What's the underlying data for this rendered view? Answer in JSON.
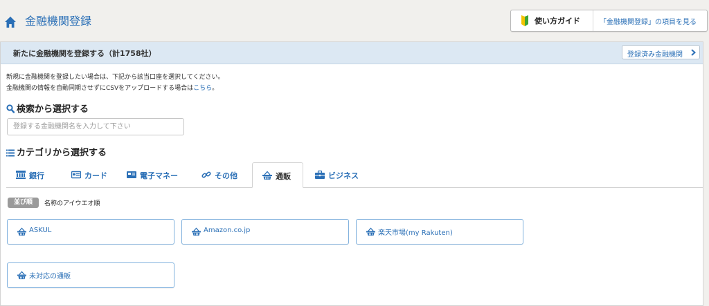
{
  "header": {
    "title": "金融機関登録",
    "guide_label": "使い方ガイド",
    "guide_link": "「金融機関登録」の項目を見る"
  },
  "panel": {
    "title": "新たに金融機関を登録する（計1758社）",
    "registered_button": "登録済み金融機関"
  },
  "intro": {
    "line1": "新規に金融機関を登録したい場合は、下記から該当口座を選択してください。",
    "line2_prefix": "金融機関の情報を自動同期させずにCSVをアップロードする場合は",
    "line2_link": "こちら",
    "line2_suffix": "。"
  },
  "search": {
    "title": "検索から選択する",
    "placeholder": "登録する金融機関名を入力して下さい",
    "value": ""
  },
  "category": {
    "title": "カテゴリから選択する",
    "tabs": [
      {
        "label": "銀行",
        "icon": "bank-icon"
      },
      {
        "label": "カード",
        "icon": "card-icon"
      },
      {
        "label": "電子マネー",
        "icon": "emoney-icon"
      },
      {
        "label": "その他",
        "icon": "link-icon"
      },
      {
        "label": "通販",
        "icon": "basket-icon",
        "active": true
      },
      {
        "label": "ビジネス",
        "icon": "briefcase-icon"
      }
    ]
  },
  "sort": {
    "badge": "並び順",
    "value": "名称のアイウエオ順"
  },
  "institutions": [
    {
      "name": "ASKUL"
    },
    {
      "name": "Amazon.co.jp"
    },
    {
      "name": "楽天市場(my Rakuten)"
    },
    {
      "name": "未対応の通販"
    }
  ],
  "colors": {
    "accent": "#2a6fb6",
    "panel_header": "#dce8f3",
    "button_border": "#7fb0dd",
    "page_bg": "#f1f0ed"
  }
}
